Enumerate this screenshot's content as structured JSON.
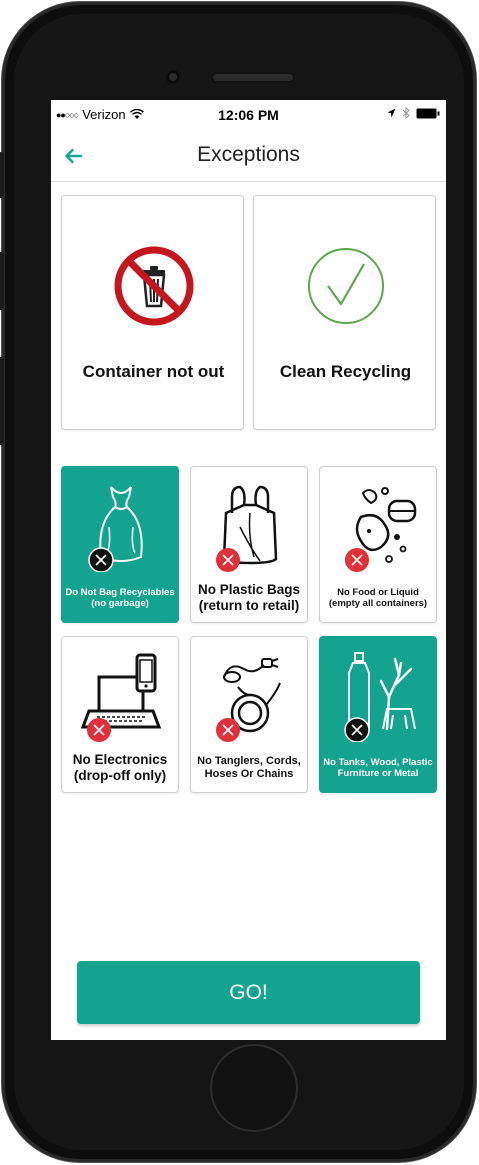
{
  "status_bar": {
    "signal": "●●○○○",
    "carrier": "Verizon",
    "time": "12:06 PM"
  },
  "nav": {
    "back_icon": "back-arrow-icon",
    "title": "Exceptions"
  },
  "cards": [
    {
      "label": "Container not out",
      "icon": "no-trash-can-icon"
    },
    {
      "label": "Clean Recycling",
      "icon": "checkmark-circle-icon"
    }
  ],
  "exceptions": [
    {
      "label": "Do Not Bag Recyclables (no garbage)",
      "icon": "bag-icon",
      "selected": true
    },
    {
      "label": "No Plastic Bags (return to retail)",
      "icon": "plastic-bag-icon",
      "selected": false
    },
    {
      "label": "No Food or Liquid (empty all containers)",
      "icon": "food-liquid-icon",
      "selected": false
    },
    {
      "label": "No Electronics (drop-off only)",
      "icon": "laptop-phone-icon",
      "selected": false
    },
    {
      "label": "No Tanglers, Cords, Hoses Or Chains",
      "icon": "cord-hose-icon",
      "selected": false
    },
    {
      "label": "No Tanks, Wood, Plastic Furniture or Metal",
      "icon": "tank-wood-icon",
      "selected": true
    }
  ],
  "go_button": {
    "label": "GO!"
  },
  "colors": {
    "accent": "#14a38f",
    "prohibited_red": "#e0313a",
    "check_green": "#5aa84a",
    "no_sign_red": "#c4161c"
  }
}
